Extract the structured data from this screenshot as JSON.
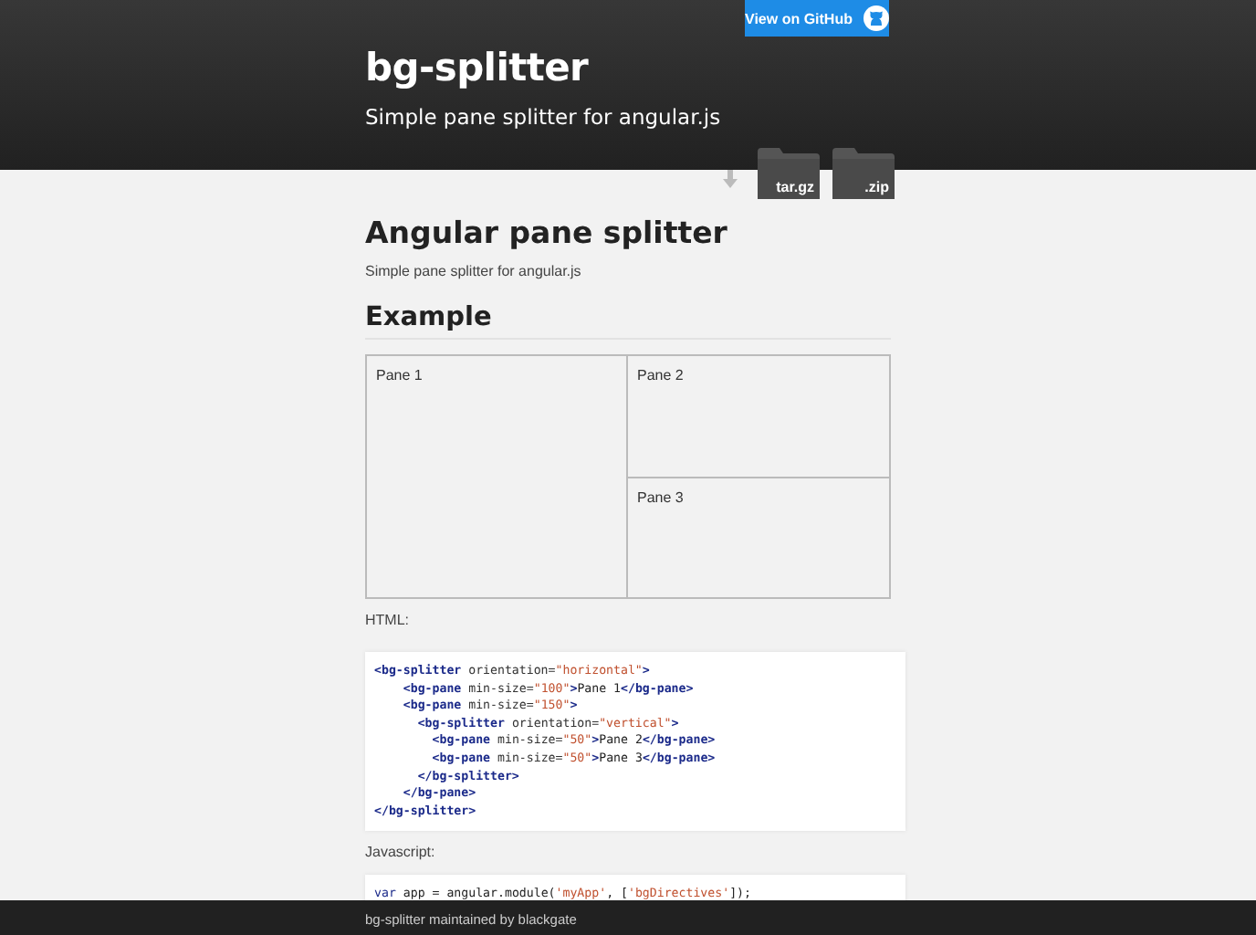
{
  "header": {
    "github_button": "View on GitHub",
    "title": "bg-splitter",
    "subtitle": "Simple pane splitter for angular.js",
    "downloads": [
      {
        "label": "tar.gz"
      },
      {
        "label": ".zip"
      }
    ]
  },
  "main": {
    "heading": "Angular pane splitter",
    "intro": "Simple pane splitter for angular.js",
    "example_heading": "Example",
    "panes": [
      "Pane 1",
      "Pane 2",
      "Pane 3"
    ],
    "html_label": "HTML:",
    "html_code": [
      [
        {
          "kind": "tag",
          "text": "<bg-splitter"
        },
        {
          "kind": "attr",
          "text": " orientation="
        },
        {
          "kind": "string",
          "text": "\"horizontal\""
        },
        {
          "kind": "tag",
          "text": ">"
        }
      ],
      [
        {
          "kind": "tag",
          "text": "    <bg-pane"
        },
        {
          "kind": "attr",
          "text": " min-size="
        },
        {
          "kind": "string",
          "text": "\"100\""
        },
        {
          "kind": "tag",
          "text": ">"
        },
        {
          "kind": "plain",
          "text": "Pane 1"
        },
        {
          "kind": "tag",
          "text": "</bg-pane>"
        }
      ],
      [
        {
          "kind": "tag",
          "text": "    <bg-pane"
        },
        {
          "kind": "attr",
          "text": " min-size="
        },
        {
          "kind": "string",
          "text": "\"150\""
        },
        {
          "kind": "tag",
          "text": ">"
        }
      ],
      [
        {
          "kind": "tag",
          "text": "      <bg-splitter"
        },
        {
          "kind": "attr",
          "text": " orientation="
        },
        {
          "kind": "string",
          "text": "\"vertical\""
        },
        {
          "kind": "tag",
          "text": ">"
        }
      ],
      [
        {
          "kind": "tag",
          "text": "        <bg-pane"
        },
        {
          "kind": "attr",
          "text": " min-size="
        },
        {
          "kind": "string",
          "text": "\"50\""
        },
        {
          "kind": "tag",
          "text": ">"
        },
        {
          "kind": "plain",
          "text": "Pane 2"
        },
        {
          "kind": "tag",
          "text": "</bg-pane>"
        }
      ],
      [
        {
          "kind": "tag",
          "text": "        <bg-pane"
        },
        {
          "kind": "attr",
          "text": " min-size="
        },
        {
          "kind": "string",
          "text": "\"50\""
        },
        {
          "kind": "tag",
          "text": ">"
        },
        {
          "kind": "plain",
          "text": "Pane 3"
        },
        {
          "kind": "tag",
          "text": "</bg-pane>"
        }
      ],
      [
        {
          "kind": "tag",
          "text": "      </bg-splitter>"
        }
      ],
      [
        {
          "kind": "tag",
          "text": "    </bg-pane>"
        }
      ],
      [
        {
          "kind": "tag",
          "text": "</bg-splitter>"
        }
      ]
    ],
    "js_label": "Javascript:",
    "js_code": [
      [
        {
          "kind": "keyword",
          "text": "var"
        },
        {
          "kind": "plain",
          "text": " app = angular.module("
        },
        {
          "kind": "string",
          "text": "'myApp'"
        },
        {
          "kind": "plain",
          "text": ", ["
        },
        {
          "kind": "string",
          "text": "'bgDirectives'"
        },
        {
          "kind": "plain",
          "text": "]);"
        }
      ]
    ]
  },
  "footer": {
    "text": "bg-splitter maintained by blackgate"
  }
}
